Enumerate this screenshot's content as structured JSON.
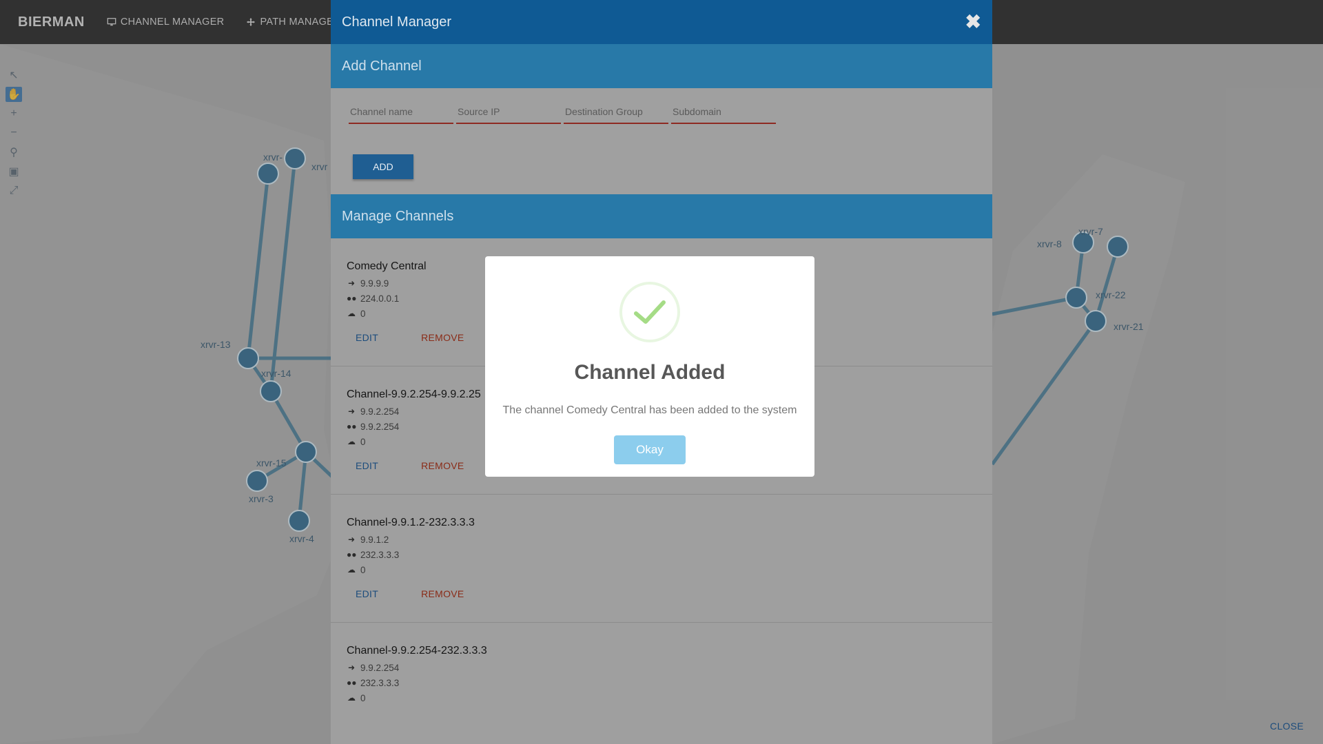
{
  "navbar": {
    "brand": "BIERMAN",
    "items": [
      {
        "label": "CHANNEL MANAGER",
        "icon": "monitor-icon"
      },
      {
        "label": "PATH MANAGER",
        "icon": "move-icon"
      }
    ]
  },
  "map": {
    "node_labels": [
      "xrvr-",
      "xrvr",
      "xrvr-13",
      "xrvr-14",
      "xrvr-15",
      "xrvr-3",
      "xrvr-4",
      "xrvr-7",
      "xrvr-8",
      "xrvr-22",
      "xrvr-21"
    ],
    "toolbar_icons": [
      "pointer-icon",
      "hand-icon",
      "zoom-in-icon",
      "zoom-out-icon",
      "magnifier-icon",
      "fit-icon",
      "fullscreen-icon"
    ]
  },
  "channel_manager": {
    "title": "Channel Manager",
    "add_section_title": "Add Channel",
    "fields": {
      "channel_name": "Channel name",
      "source_ip": "Source IP",
      "destination_group": "Destination Group",
      "subdomain": "Subdomain"
    },
    "add_label": "ADD",
    "manage_section_title": "Manage Channels",
    "channels": [
      {
        "name": "Comedy Central",
        "source": "9.9.9.9",
        "group": "224.0.0.1",
        "subdomain": "0"
      },
      {
        "name": "Channel-9.9.2.254-9.9.2.25",
        "source": "9.9.2.254",
        "group": "9.9.2.254",
        "subdomain": "0"
      },
      {
        "name": "Channel-9.9.1.2-232.3.3.3",
        "source": "9.9.1.2",
        "group": "232.3.3.3",
        "subdomain": "0"
      },
      {
        "name": "Channel-9.9.2.254-232.3.3.3",
        "source": "9.9.2.254",
        "group": "232.3.3.3",
        "subdomain": "0"
      }
    ],
    "edit_label": "EDIT",
    "remove_label": "REMOVE",
    "close_label": "CLOSE"
  },
  "dialog": {
    "title": "Channel Added",
    "text": "The channel Comedy Central has been added to the system",
    "button": "Okay",
    "icon": "checkmark-icon"
  },
  "colors": {
    "header": "#0f5a94",
    "section": "#2879a8",
    "success": "#a5dc86",
    "okay_button": "#8ccded"
  }
}
